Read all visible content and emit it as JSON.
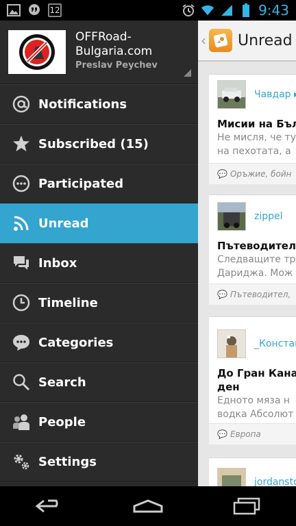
{
  "status_bar": {
    "time": "9:43",
    "notification_count": "12"
  },
  "account": {
    "site_name": "OFFRoad-Bulgaria.com",
    "user_name": "Preslav Peychev"
  },
  "menu": [
    {
      "label": "Notifications",
      "icon": "at-icon"
    },
    {
      "label": "Subscribed (15)",
      "icon": "star-icon"
    },
    {
      "label": "Participated",
      "icon": "chat-bubble-icon"
    },
    {
      "label": "Unread",
      "icon": "rss-icon",
      "active": true
    },
    {
      "label": "Inbox",
      "icon": "inbox-icon"
    },
    {
      "label": "Timeline",
      "icon": "clock-icon"
    },
    {
      "label": "Categories",
      "icon": "categories-icon"
    },
    {
      "label": "Search",
      "icon": "search-icon"
    },
    {
      "label": "People",
      "icon": "people-icon"
    },
    {
      "label": "Settings",
      "icon": "gear-icon"
    }
  ],
  "action_bar": {
    "title": "Unread"
  },
  "cards": [
    {
      "author": "Чавдар ▸ ...",
      "title": "Мисии на Бълг",
      "snippet": [
        "Не мисля, че ту",
        "на пехотата, а"
      ],
      "category": "Оръжие, бойн"
    },
    {
      "author": "zippel",
      "title": "Пътеводител з",
      "snippet": [
        "Следващите тр",
        "Дариджа. Мож"
      ],
      "category": "Пътеводител,"
    },
    {
      "author": "_Констан",
      "title": "До Гран Канар",
      "title2": "ден",
      "snippet": [
        "Едното мяза н",
        "водка Абсолют"
      ],
      "category": "Европа"
    },
    {
      "author": "jordansto"
    }
  ],
  "colors": {
    "accent": "#33a5cf",
    "drawer": "#2b2b2b",
    "status_blue": "#33b5e5"
  }
}
